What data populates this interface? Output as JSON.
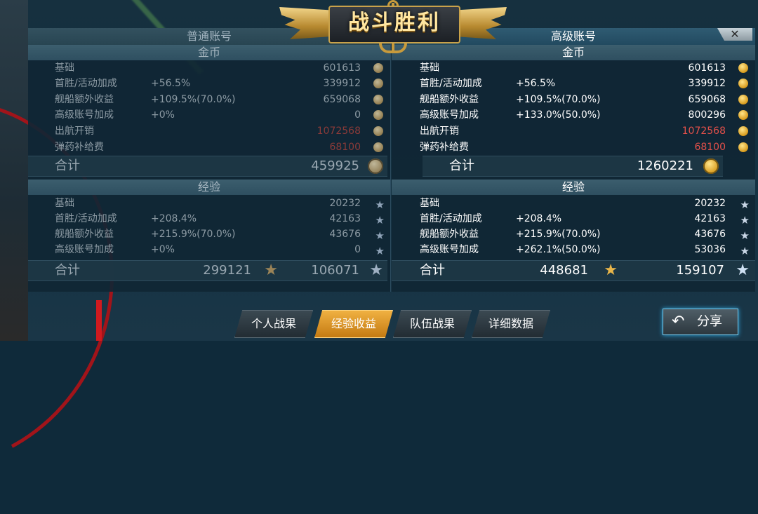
{
  "banner": {
    "title": "战斗胜利"
  },
  "close_label": "✕",
  "normal": {
    "tab": "普通账号",
    "gold": {
      "header": "金币",
      "rows": [
        {
          "label": "基础",
          "bonus": "",
          "value": "601613"
        },
        {
          "label": "首胜/活动加成",
          "bonus": "+56.5%",
          "value": "339912"
        },
        {
          "label": "舰船额外收益",
          "bonus": "+109.5%(70.0%)",
          "value": "659068"
        },
        {
          "label": "高级账号加成",
          "bonus": "+0%",
          "value": "0"
        },
        {
          "label": "出航开销",
          "bonus": "",
          "value": "1072568"
        },
        {
          "label": "弹药补给费",
          "bonus": "",
          "value": "68100"
        }
      ],
      "total_label": "合计",
      "total": "459925"
    },
    "exp": {
      "header": "经验",
      "rows": [
        {
          "label": "基础",
          "bonus": "",
          "value": "20232"
        },
        {
          "label": "首胜/活动加成",
          "bonus": "+208.4%",
          "value": "42163"
        },
        {
          "label": "舰船额外收益",
          "bonus": "+215.9%(70.0%)",
          "value": "43676"
        },
        {
          "label": "高级账号加成",
          "bonus": "+0%",
          "value": "0"
        }
      ],
      "total_label": "合计",
      "total_gold_star": "299121",
      "total_silver_star": "106071"
    }
  },
  "premium": {
    "tab": "高级账号",
    "gold": {
      "header": "金币",
      "rows": [
        {
          "label": "基础",
          "bonus": "",
          "value": "601613"
        },
        {
          "label": "首胜/活动加成",
          "bonus": "+56.5%",
          "value": "339912"
        },
        {
          "label": "舰船额外收益",
          "bonus": "+109.5%(70.0%)",
          "value": "659068"
        },
        {
          "label": "高级账号加成",
          "bonus": "+133.0%(50.0%)",
          "value": "800296"
        },
        {
          "label": "出航开销",
          "bonus": "",
          "value": "1072568"
        },
        {
          "label": "弹药补给费",
          "bonus": "",
          "value": "68100"
        }
      ],
      "total_label": "合计",
      "total": "1260221"
    },
    "exp": {
      "header": "经验",
      "rows": [
        {
          "label": "基础",
          "bonus": "",
          "value": "20232"
        },
        {
          "label": "首胜/活动加成",
          "bonus": "+208.4%",
          "value": "42163"
        },
        {
          "label": "舰船额外收益",
          "bonus": "+215.9%(70.0%)",
          "value": "43676"
        },
        {
          "label": "高级账号加成",
          "bonus": "+262.1%(50.0%)",
          "value": "53036"
        }
      ],
      "total_label": "合计",
      "total_gold_star": "448681",
      "total_silver_star": "159107"
    }
  },
  "bottom_tabs": [
    {
      "label": "个人战果",
      "active": false
    },
    {
      "label": "经验收益",
      "active": true
    },
    {
      "label": "队伍战果",
      "active": false
    },
    {
      "label": "详细数据",
      "active": false
    }
  ],
  "share": {
    "label": "分享"
  },
  "colors": {
    "accent_gold": "#e9b64a",
    "active_tab": "#f0b142",
    "negative": "#e3504a",
    "share_glow": "#2fa8e0"
  }
}
